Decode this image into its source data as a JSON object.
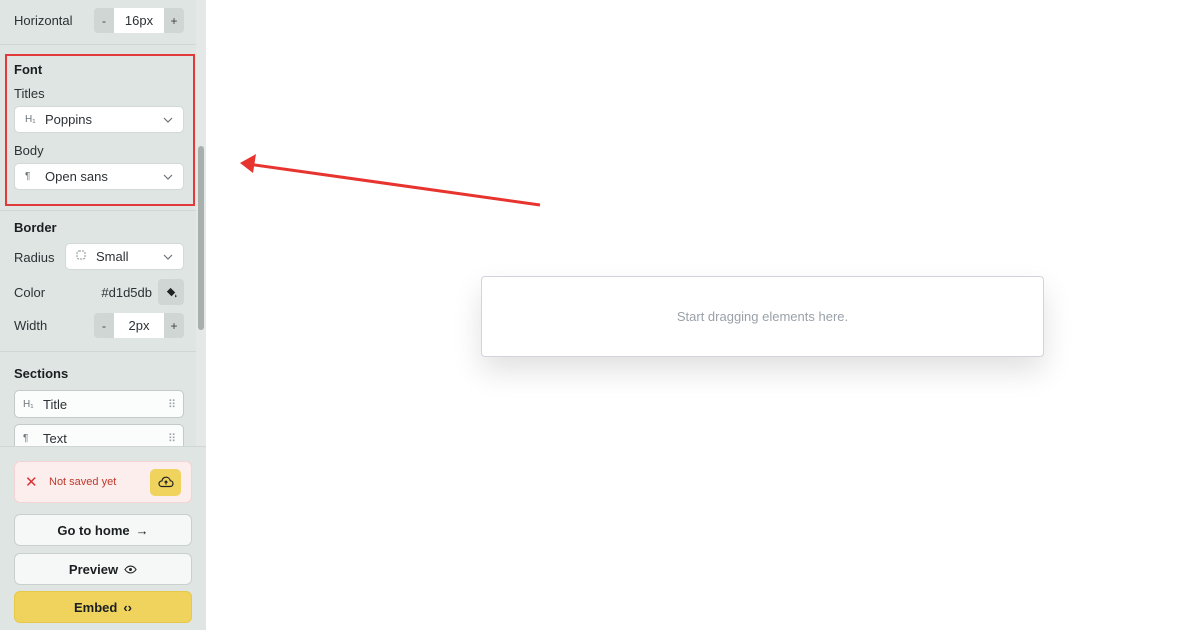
{
  "sidebar": {
    "padding": {
      "horizontal_label": "Horizontal",
      "horizontal_value": "16px",
      "minus": "-",
      "plus": "+"
    },
    "font": {
      "title": "Font",
      "titles_label": "Titles",
      "titles_icon": "H₁",
      "titles_value": "Poppins",
      "body_label": "Body",
      "body_icon": "¶",
      "body_value": "Open sans"
    },
    "border": {
      "title": "Border",
      "radius_label": "Radius",
      "radius_value": "Small",
      "color_label": "Color",
      "color_value": "#d1d5db",
      "width_label": "Width",
      "width_value": "2px",
      "minus": "-",
      "plus": "+"
    },
    "sections": {
      "title": "Sections",
      "items": [
        {
          "icon": "H₁",
          "label": "Title"
        },
        {
          "icon": "¶",
          "label": "Text"
        }
      ]
    }
  },
  "bottom": {
    "status_text": "Not saved yet",
    "go_home_label": "Go to home",
    "go_home_icon": "→",
    "preview_label": "Preview",
    "embed_label": "Embed",
    "embed_icon": "‹›"
  },
  "canvas": {
    "placeholder": "Start dragging elements here."
  },
  "colors": {
    "accent_yellow": "#efd35c",
    "highlight_red": "#e23a3a",
    "sidebar_bg": "#dfe5e2"
  }
}
